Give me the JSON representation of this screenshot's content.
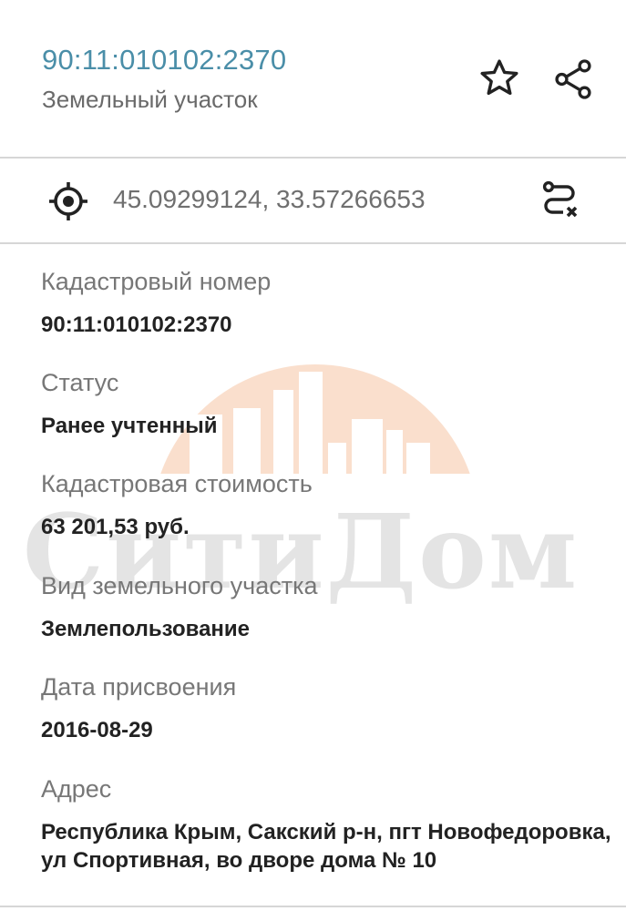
{
  "header": {
    "cadastral_title": "90:11:010102:2370",
    "subtitle": "Земельный участок",
    "favorite_icon": "star-outline-icon",
    "share_icon": "share-icon"
  },
  "coordinates": {
    "locate_icon": "crosshair-target-icon",
    "value": "45.09299124, 33.57266653",
    "route_icon": "route-clear-icon"
  },
  "watermark": {
    "text": "СитиДом",
    "colors": {
      "sun": "#f9d9c4",
      "text": "#e4e4e4"
    }
  },
  "fields": [
    {
      "label": "Кадастровый номер",
      "value": "90:11:010102:2370"
    },
    {
      "label": "Статус",
      "value": "Ранее учтенный"
    },
    {
      "label": "Кадастровая стоимость",
      "value": "63 201,53 руб."
    },
    {
      "label": "Вид земельного участка",
      "value": "Землепользование"
    },
    {
      "label": "Дата присвоения",
      "value": "2016-08-29"
    },
    {
      "label": "Адрес",
      "value": "Республика Крым, Сакский р-н, пгт Новофедоровка, ул Спортивная, во дворе дома № 10"
    }
  ],
  "colors": {
    "accent": "#4a8ea8",
    "label": "#777777",
    "value": "#222222",
    "divider": "#d6d6d6"
  }
}
